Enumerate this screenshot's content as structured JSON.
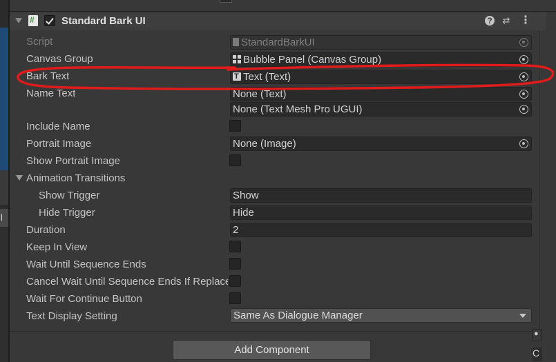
{
  "component": {
    "title": "Standard Bark UI",
    "help_icon_glyph": "?",
    "preset_icon_glyph": "⇄",
    "menu_icon_glyph": "⋮",
    "enabled": true
  },
  "fields": {
    "script": {
      "label": "Script",
      "value": "StandardBarkUI"
    },
    "canvas_group": {
      "label": "Canvas Group",
      "value": "Bubble Panel (Canvas Group)"
    },
    "bark_text": {
      "label": "Bark Text",
      "value": "Text (Text)"
    },
    "name_text": {
      "label": "Name Text",
      "value": "None (Text)",
      "value2": "None (Text Mesh Pro UGUI)"
    },
    "include_name": {
      "label": "Include Name",
      "checked": false
    },
    "portrait_image": {
      "label": "Portrait Image",
      "value": "None (Image)"
    },
    "show_portrait_image": {
      "label": "Show Portrait Image",
      "checked": false
    },
    "animation_transitions": {
      "label": "Animation Transitions"
    },
    "show_trigger": {
      "label": "Show Trigger",
      "value": "Show"
    },
    "hide_trigger": {
      "label": "Hide Trigger",
      "value": "Hide"
    },
    "duration": {
      "label": "Duration",
      "value": "2"
    },
    "keep_in_view": {
      "label": "Keep In View",
      "checked": false
    },
    "wait_until_sequence_ends": {
      "label": "Wait Until Sequence Ends",
      "checked": false
    },
    "cancel_wait": {
      "label": "Cancel Wait Until Sequence Ends If Replaced",
      "checked": false
    },
    "wait_for_continue": {
      "label": "Wait For Continue Button",
      "checked": false
    },
    "text_display_setting": {
      "label": "Text Display Setting",
      "value": "Same As Dialogue Manager"
    }
  },
  "add_component_label": "Add Component",
  "scene_tab_char": "l",
  "corner_letter": "C",
  "annotation_color": "#e01b1b"
}
